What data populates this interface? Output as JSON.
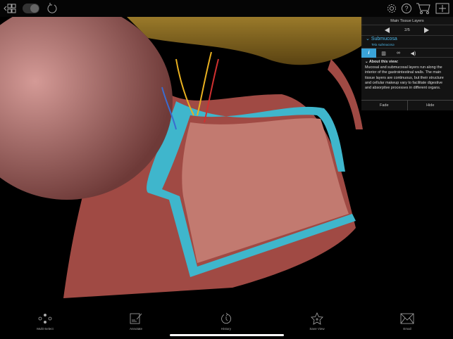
{
  "panel": {
    "title": "Main Tissue Layers",
    "page": "2/5",
    "structure_name": "Submucosa",
    "structure_latin": "Tela submucosa",
    "about_heading": "About this view:",
    "about_text": "Mucosal and submucosal layers run along the interior of the gastrointestinal walls. The main tissue layers are continuous, but their structure and cellular makeup vary to facilitate digestive and absorptive processes in different organs.",
    "fade_label": "Fade",
    "hide_label": "Hide"
  },
  "toolbar": {
    "items": [
      {
        "label": "Multi-Select",
        "icon": "multi-select-icon"
      },
      {
        "label": "Annotate",
        "icon": "annotate-icon"
      },
      {
        "label": "History",
        "icon": "history-icon"
      },
      {
        "label": "Save View",
        "icon": "save-view-icon"
      },
      {
        "label": "Email",
        "icon": "email-icon"
      }
    ]
  },
  "colors": {
    "accent": "#3aa3d8",
    "submucosa": "#3fb6cc",
    "muscle": "#b0504a"
  }
}
